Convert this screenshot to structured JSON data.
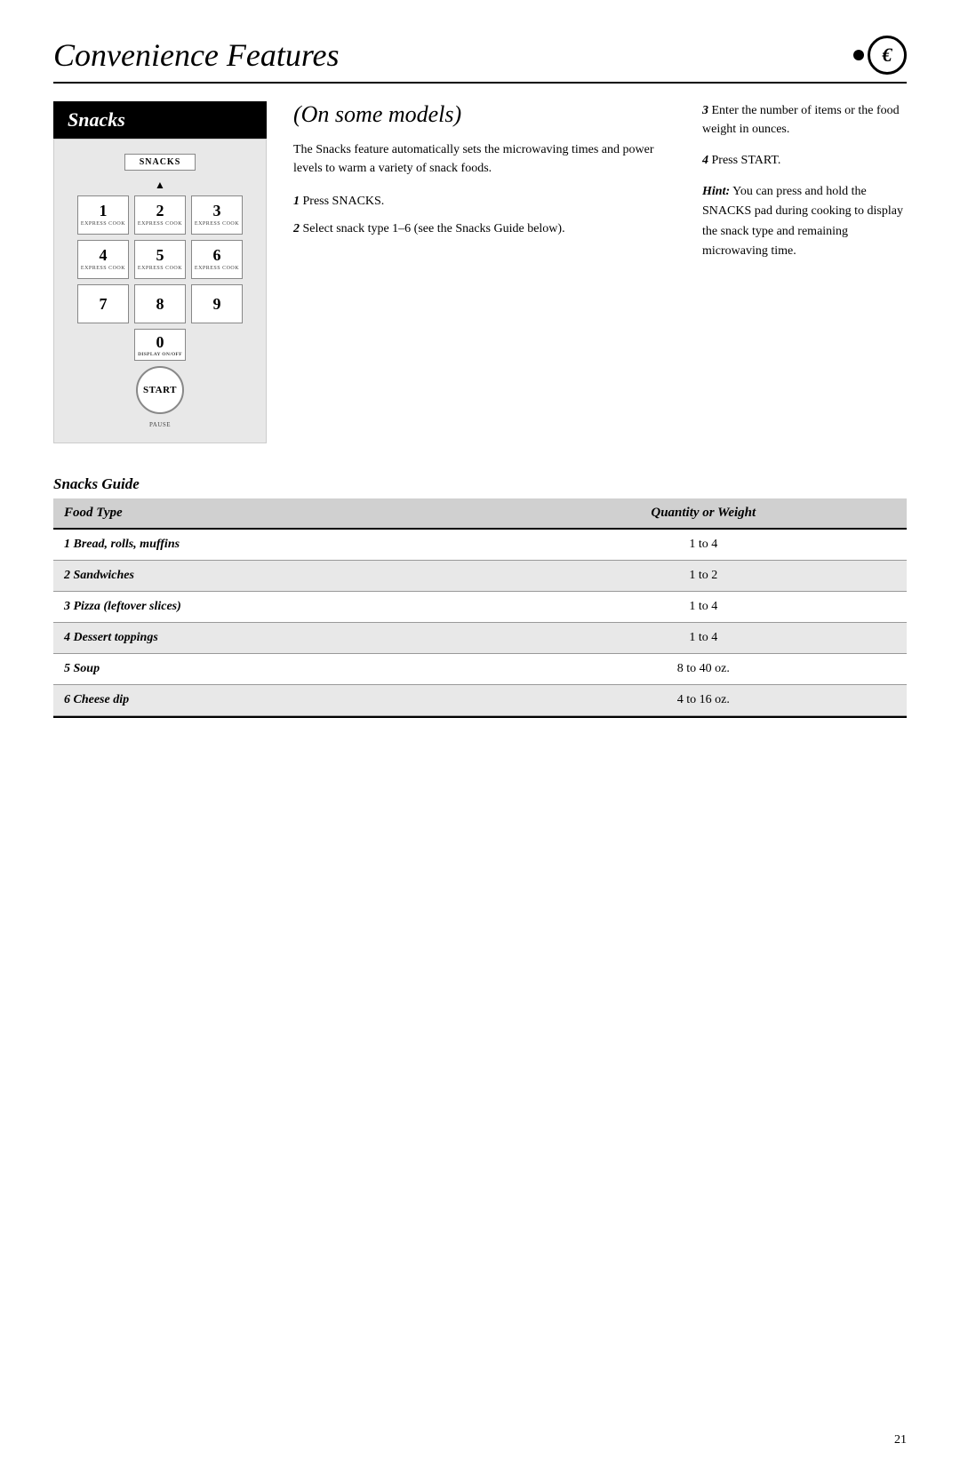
{
  "header": {
    "title": "Convenience Features",
    "page_number": "21"
  },
  "section": {
    "title": "Snacks",
    "subtitle": "(On some models)"
  },
  "keypad": {
    "snacks_label": "SNACKS",
    "keys": [
      {
        "num": "1",
        "sublabel": "EXPRESS COOK"
      },
      {
        "num": "2",
        "sublabel": "EXPRESS COOK"
      },
      {
        "num": "3",
        "sublabel": "EXPRESS COOK"
      },
      {
        "num": "4",
        "sublabel": "EXPRESS COOK"
      },
      {
        "num": "5",
        "sublabel": "EXPRESS COOK"
      },
      {
        "num": "6",
        "sublabel": "EXPRESS COOK"
      },
      {
        "num": "7",
        "sublabel": ""
      },
      {
        "num": "8",
        "sublabel": ""
      },
      {
        "num": "9",
        "sublabel": ""
      }
    ],
    "zero": "0",
    "display_label": "DISPLAY ON/OFF",
    "start_label": "START",
    "pause_label": "PAUSE"
  },
  "intro_text": "The Snacks feature automatically sets the microwaving times and power levels to warm a variety of snack foods.",
  "steps": [
    {
      "num": "1",
      "text": "Press SNACKS."
    },
    {
      "num": "2",
      "text": "Select snack type 1–6 (see the Snacks Guide below)."
    },
    {
      "num": "3",
      "text": "Enter the number of items or the food weight in ounces."
    },
    {
      "num": "4",
      "text": "Press START."
    }
  ],
  "hint": {
    "label": "Hint:",
    "text": "You can press and hold the SNACKS pad during cooking to display the snack type and remaining microwaving time."
  },
  "snacks_guide": {
    "title": "Snacks Guide",
    "columns": [
      "Food Type",
      "Quantity or Weight"
    ],
    "rows": [
      {
        "food": "1 Bread, rolls, muffins",
        "quantity": "1 to 4"
      },
      {
        "food": "2 Sandwiches",
        "quantity": "1 to 2"
      },
      {
        "food": "3 Pizza (leftover slices)",
        "quantity": "1 to 4"
      },
      {
        "food": "4 Dessert toppings",
        "quantity": "1 to 4"
      },
      {
        "food": "5 Soup",
        "quantity": "8 to 40 oz."
      },
      {
        "food": "6 Cheese dip",
        "quantity": "4 to 16 oz."
      }
    ]
  }
}
